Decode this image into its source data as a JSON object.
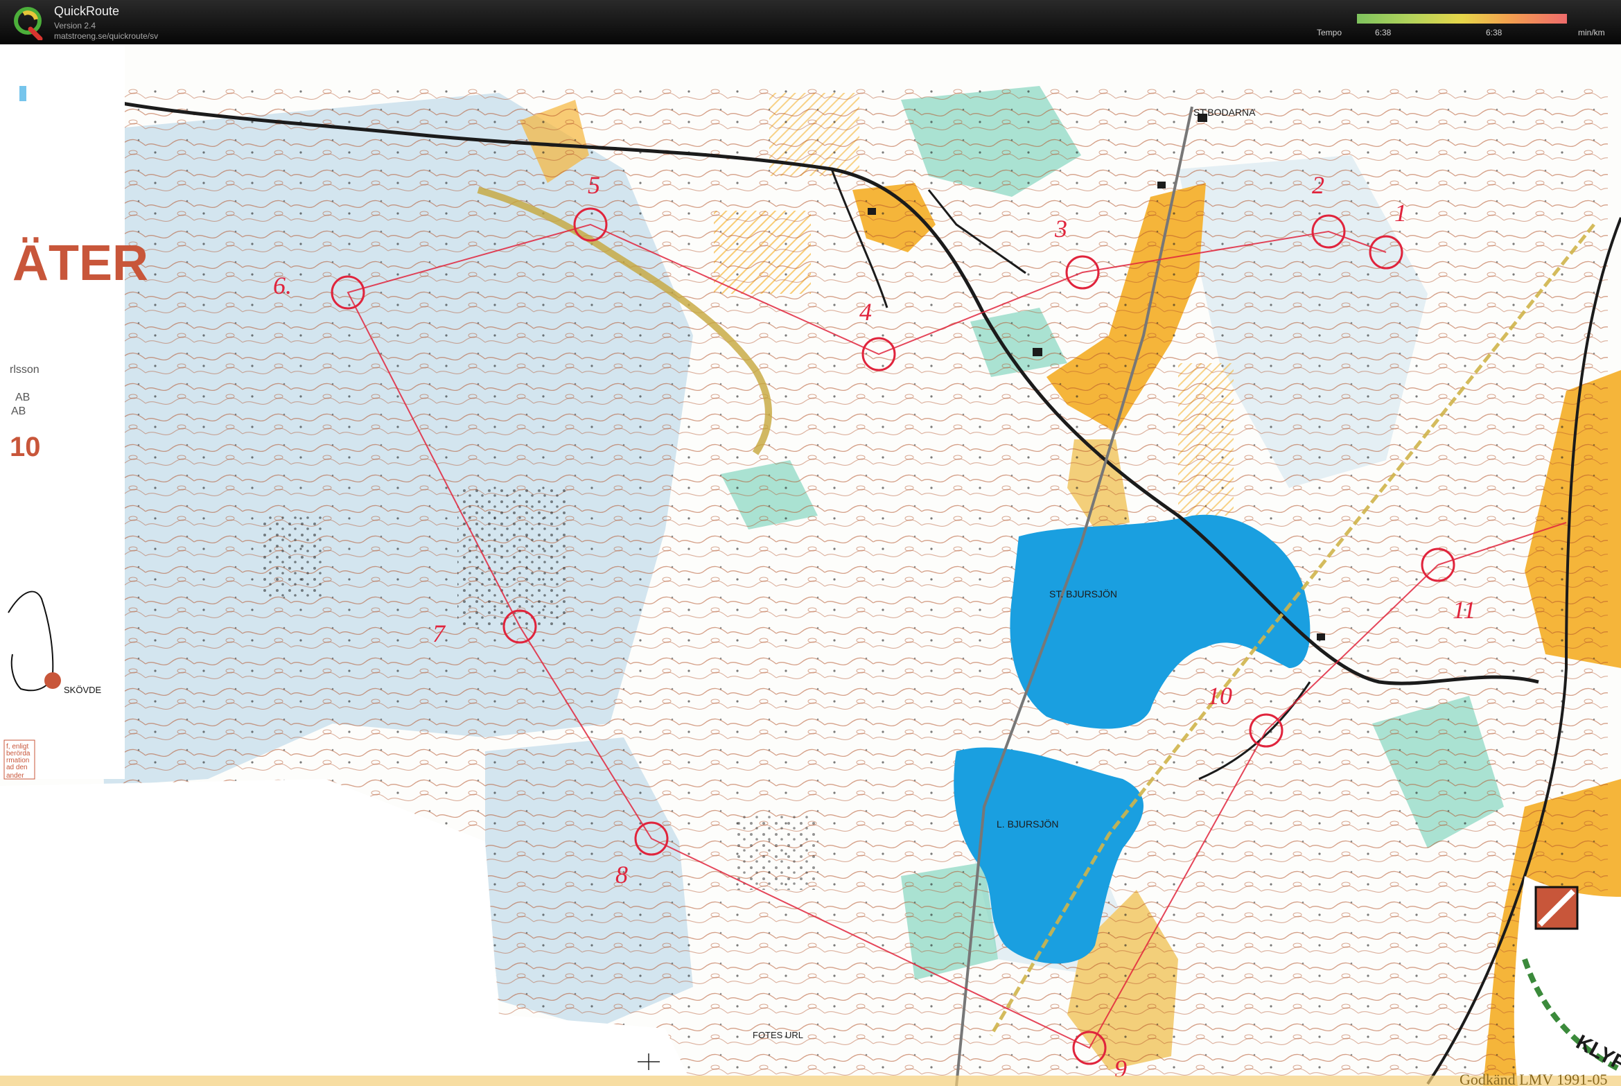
{
  "app": {
    "name": "QuickRoute",
    "version": "Version 2.4",
    "url": "matstroeng.se/quickroute/sv"
  },
  "tempo": {
    "label": "Tempo",
    "tick_low": "6:38",
    "tick_mid": "6:38",
    "unit": "min/km"
  },
  "map": {
    "legend_title_fragment": "ÄTER",
    "legend_name_fragment": "rlsson",
    "legend_ab1": "AB",
    "legend_ab2": "AB",
    "legend_number": "10",
    "legend_town": "SKÖVDE",
    "legend_note1": "f, enligt",
    "legend_note2": "berörda",
    "legend_note3": "rmation",
    "legend_note4": "ad den",
    "legend_note5": "ander",
    "place_st_bodarna": "ST.BODARNA",
    "place_st_bjursjon": "ST. BJURSJÖN",
    "place_l_bjursjon": "L. BJURSJÖN",
    "place_fotes_url": "FOTES URL",
    "approved_text": "Godkänd LMV 1991-05",
    "club_text": "KLYF",
    "controls": [
      {
        "number": "1"
      },
      {
        "number": "2"
      },
      {
        "number": "3"
      },
      {
        "number": "4"
      },
      {
        "number": "5"
      },
      {
        "number": "6."
      },
      {
        "number": "7"
      },
      {
        "number": "8"
      },
      {
        "number": "9"
      },
      {
        "number": "10"
      },
      {
        "number": "11"
      }
    ],
    "colors": {
      "water": "#1a9fe0",
      "marsh_blue": "#cfe3ee",
      "open_land": "#f5b53a",
      "green": "#8ed8c4",
      "course": "#e0243c",
      "contour": "#b4532a"
    }
  }
}
